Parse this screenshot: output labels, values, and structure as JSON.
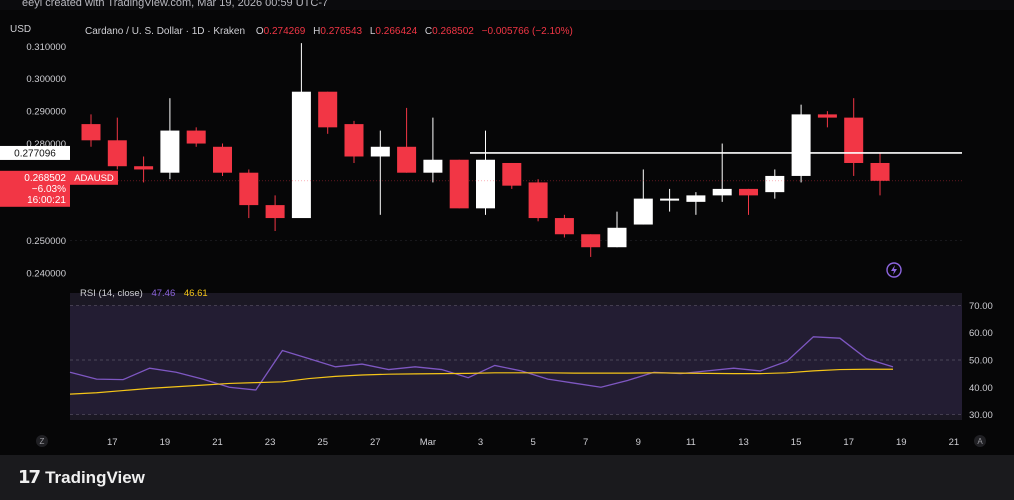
{
  "credit": "eeyi created with TradingView.com, Mar 19, 2026 00:59 UTC-7",
  "currency": "USD",
  "legend": {
    "symbol": "Cardano / U. S. Dollar · 1D · Kraken",
    "open_label": "O",
    "open": "0.274269",
    "high_label": "H",
    "high": "0.276543",
    "low_label": "L",
    "low": "0.266424",
    "close_label": "C",
    "close": "0.268502",
    "change": "−0.005766 (−2.10%)"
  },
  "price_axis": {
    "ticks": [
      "0.310000",
      "0.300000",
      "0.290000",
      "0.280000",
      "0.250000",
      "0.240000"
    ],
    "hline_label": "0.277096",
    "current_price": "0.268502",
    "current_change": "−6.03%",
    "countdown": "16:00:21",
    "symbol_tag": "ADAUSD"
  },
  "rsi": {
    "title": "RSI (14, close)",
    "value": "47.46",
    "ma_value": "46.61",
    "ticks": [
      "70.00",
      "60.00",
      "50.00",
      "40.00",
      "30.00"
    ]
  },
  "x_axis": {
    "labels": [
      "17",
      "19",
      "21",
      "23",
      "25",
      "27",
      "Mar",
      "3",
      "5",
      "7",
      "9",
      "11",
      "13",
      "15",
      "17",
      "19",
      "21"
    ],
    "left_btn": "Z",
    "right_btn": "A"
  },
  "footer": {
    "logo_text": "TradingView"
  },
  "colors": {
    "up": "#ffffff",
    "down": "#f23645",
    "rsi": "#7e57c2",
    "rsi_ma": "#f5c518",
    "hline": "#ffffff"
  },
  "chart_data": {
    "type": "candlestick",
    "title": "Cardano / U. S. Dollar · 1D · Kraken",
    "ylim": [
      0.2385,
      0.3135
    ],
    "hline": 0.277096,
    "candles": [
      {
        "date": "Feb 16",
        "o": 0.286,
        "h": 0.289,
        "l": 0.279,
        "c": 0.281
      },
      {
        "date": "Feb 17",
        "o": 0.281,
        "h": 0.288,
        "l": 0.272,
        "c": 0.273
      },
      {
        "date": "Feb 18",
        "o": 0.273,
        "h": 0.276,
        "l": 0.268,
        "c": 0.272
      },
      {
        "date": "Feb 19",
        "o": 0.271,
        "h": 0.294,
        "l": 0.269,
        "c": 0.284
      },
      {
        "date": "Feb 20",
        "o": 0.284,
        "h": 0.285,
        "l": 0.279,
        "c": 0.28
      },
      {
        "date": "Feb 21",
        "o": 0.279,
        "h": 0.28,
        "l": 0.27,
        "c": 0.271
      },
      {
        "date": "Feb 22",
        "o": 0.271,
        "h": 0.272,
        "l": 0.257,
        "c": 0.261
      },
      {
        "date": "Feb 23",
        "o": 0.261,
        "h": 0.264,
        "l": 0.253,
        "c": 0.257
      },
      {
        "date": "Feb 24",
        "o": 0.257,
        "h": 0.311,
        "l": 0.257,
        "c": 0.296
      },
      {
        "date": "Feb 25",
        "o": 0.296,
        "h": 0.296,
        "l": 0.283,
        "c": 0.285
      },
      {
        "date": "Feb 26",
        "o": 0.286,
        "h": 0.287,
        "l": 0.274,
        "c": 0.276
      },
      {
        "date": "Feb 27",
        "o": 0.276,
        "h": 0.284,
        "l": 0.258,
        "c": 0.279
      },
      {
        "date": "Feb 28",
        "o": 0.279,
        "h": 0.291,
        "l": 0.271,
        "c": 0.271
      },
      {
        "date": "Mar 1",
        "o": 0.271,
        "h": 0.288,
        "l": 0.268,
        "c": 0.275
      },
      {
        "date": "Mar 2",
        "o": 0.275,
        "h": 0.275,
        "l": 0.26,
        "c": 0.26
      },
      {
        "date": "Mar 3",
        "o": 0.26,
        "h": 0.284,
        "l": 0.258,
        "c": 0.275
      },
      {
        "date": "Mar 4",
        "o": 0.274,
        "h": 0.274,
        "l": 0.266,
        "c": 0.267
      },
      {
        "date": "Mar 5",
        "o": 0.268,
        "h": 0.269,
        "l": 0.256,
        "c": 0.257
      },
      {
        "date": "Mar 6",
        "o": 0.257,
        "h": 0.258,
        "l": 0.251,
        "c": 0.252
      },
      {
        "date": "Mar 7",
        "o": 0.252,
        "h": 0.252,
        "l": 0.245,
        "c": 0.248
      },
      {
        "date": "Mar 8",
        "o": 0.248,
        "h": 0.259,
        "l": 0.248,
        "c": 0.254
      },
      {
        "date": "Mar 9",
        "o": 0.255,
        "h": 0.272,
        "l": 0.255,
        "c": 0.263
      },
      {
        "date": "Mar 10",
        "o": 0.263,
        "h": 0.266,
        "l": 0.259,
        "c": 0.263
      },
      {
        "date": "Mar 11",
        "o": 0.262,
        "h": 0.265,
        "l": 0.258,
        "c": 0.264
      },
      {
        "date": "Mar 12",
        "o": 0.264,
        "h": 0.28,
        "l": 0.262,
        "c": 0.266
      },
      {
        "date": "Mar 13",
        "o": 0.266,
        "h": 0.266,
        "l": 0.258,
        "c": 0.264
      },
      {
        "date": "Mar 14",
        "o": 0.265,
        "h": 0.272,
        "l": 0.263,
        "c": 0.27
      },
      {
        "date": "Mar 15",
        "o": 0.27,
        "h": 0.292,
        "l": 0.268,
        "c": 0.289
      },
      {
        "date": "Mar 16",
        "o": 0.289,
        "h": 0.29,
        "l": 0.285,
        "c": 0.288
      },
      {
        "date": "Mar 17",
        "o": 0.288,
        "h": 0.294,
        "l": 0.27,
        "c": 0.274
      },
      {
        "date": "Mar 18",
        "o": 0.274,
        "h": 0.277,
        "l": 0.264,
        "c": 0.2685
      }
    ],
    "rsi_ylim": [
      28,
      72
    ],
    "rsi_series": [
      45.5,
      43.0,
      42.8,
      47.0,
      45.5,
      43.0,
      40.0,
      39.0,
      53.5,
      50.5,
      47.5,
      48.5,
      46.5,
      47.5,
      46.5,
      43.5,
      48.0,
      46.0,
      43.0,
      41.5,
      40.0,
      42.5,
      45.5,
      45.0,
      46.0,
      47.0,
      46.0,
      49.5,
      58.5,
      58.0,
      50.5,
      47.5
    ],
    "rsi_ma_series": [
      37.5,
      38.0,
      38.8,
      39.6,
      40.2,
      40.8,
      41.4,
      41.7,
      42.0,
      43.2,
      44.0,
      44.5,
      44.8,
      44.9,
      45.0,
      45.1,
      45.3,
      45.3,
      45.3,
      45.2,
      45.2,
      45.2,
      45.3,
      45.2,
      45.1,
      45.0,
      45.0,
      45.3,
      46.0,
      46.5,
      46.6,
      46.61
    ]
  }
}
